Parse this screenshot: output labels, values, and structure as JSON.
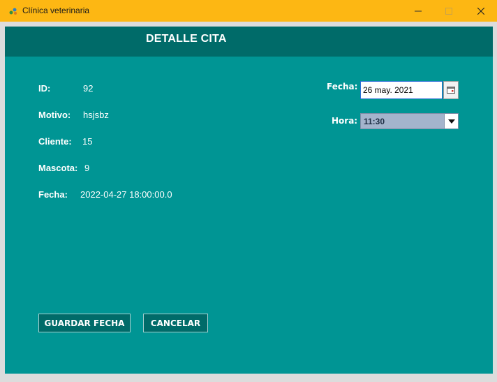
{
  "window": {
    "title": "Clínica veterinaria",
    "icons": {
      "app": "paw-app-icon",
      "minimize": "minimize-icon",
      "maximize": "maximize-icon",
      "close": "close-icon"
    }
  },
  "header": {
    "title": "DETALLE CITA"
  },
  "details": {
    "id_label": "ID:",
    "id_value": "92",
    "motivo_label": "Motivo:",
    "motivo_value": "hsjsbz",
    "cliente_label": "Cliente:",
    "cliente_value": "15",
    "mascota_label": "Mascota:",
    "mascota_value": "9",
    "fecha_label": "Fecha:",
    "fecha_value": "2022-04-27 18:00:00.0"
  },
  "editor": {
    "fecha_label": "Fecha:",
    "fecha_value": "26 may. 2021",
    "calendar_icon": "calendar-icon",
    "hora_label": "Hora:",
    "hora_value": "11:30"
  },
  "actions": {
    "save_label": "GUARDAR FECHA",
    "cancel_label": "CANCELAR"
  },
  "colors": {
    "titlebar": "#fdb713",
    "header": "#006b69",
    "panel": "#009594",
    "button": "#006b69",
    "select": "#a4b4cc"
  }
}
